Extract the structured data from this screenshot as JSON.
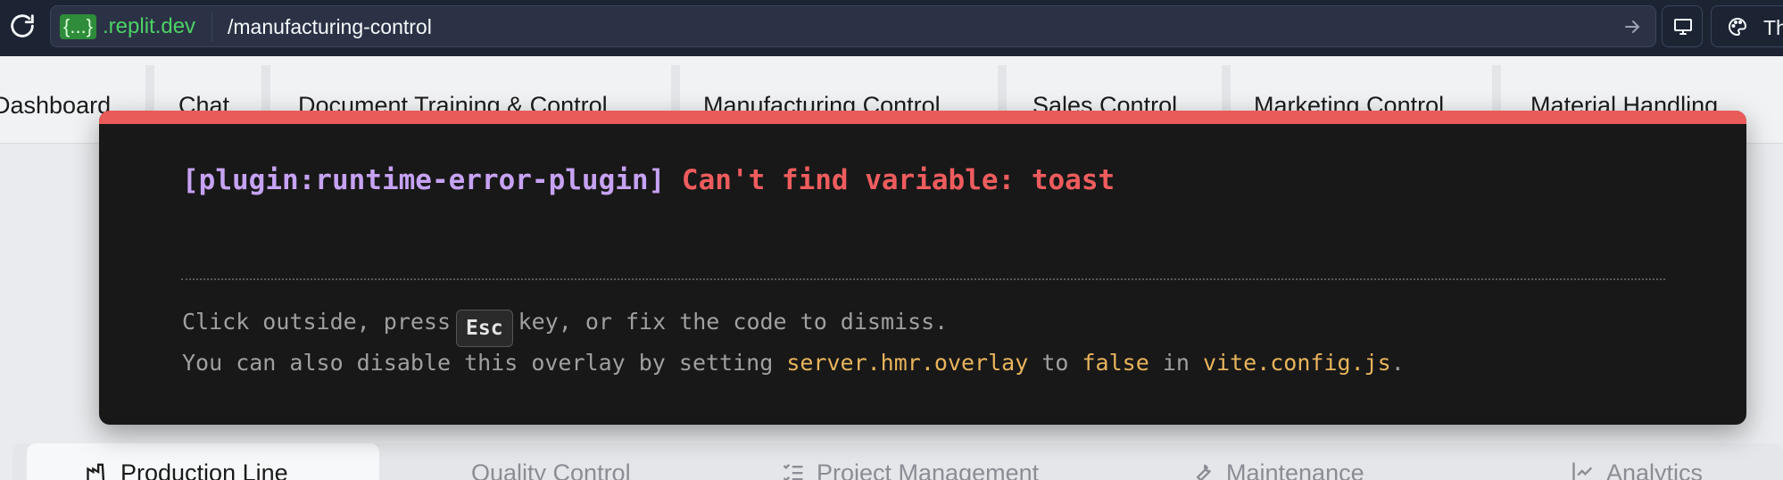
{
  "browser": {
    "host_badge": "{...}",
    "host_rest": ".replit.dev",
    "url_path": "/manufacturing-control",
    "theme_label": "Th"
  },
  "app": {
    "nav_tabs": [
      "Dashboard",
      "Chat",
      "Document Training & Control",
      "Manufacturing Control",
      "Sales Control",
      "Marketing Control",
      "Material Handling"
    ],
    "sub_tabs": [
      "Production Line",
      "Quality Control",
      "Project Management",
      "Maintenance",
      "Analytics"
    ]
  },
  "overlay": {
    "plugin": "[plugin:runtime-error-plugin]",
    "message": "Can't find variable: toast",
    "tip1_before": "Click outside, press",
    "tip1_key": "Esc",
    "tip1_after": "key, or fix the code to dismiss.",
    "tip2_a": "You can also disable this overlay by setting",
    "tip2_code1": "server.hmr.overlay",
    "tip2_b": "to",
    "tip2_code2": "false",
    "tip2_c": "in",
    "tip2_code3": "vite.config.js",
    "tip2_d": "."
  },
  "colors": {
    "accent_bar": "#e95b58",
    "plugin_text": "#c6a2f4",
    "error_text": "#ef5c5e",
    "highlight_text": "#e8b45c"
  }
}
